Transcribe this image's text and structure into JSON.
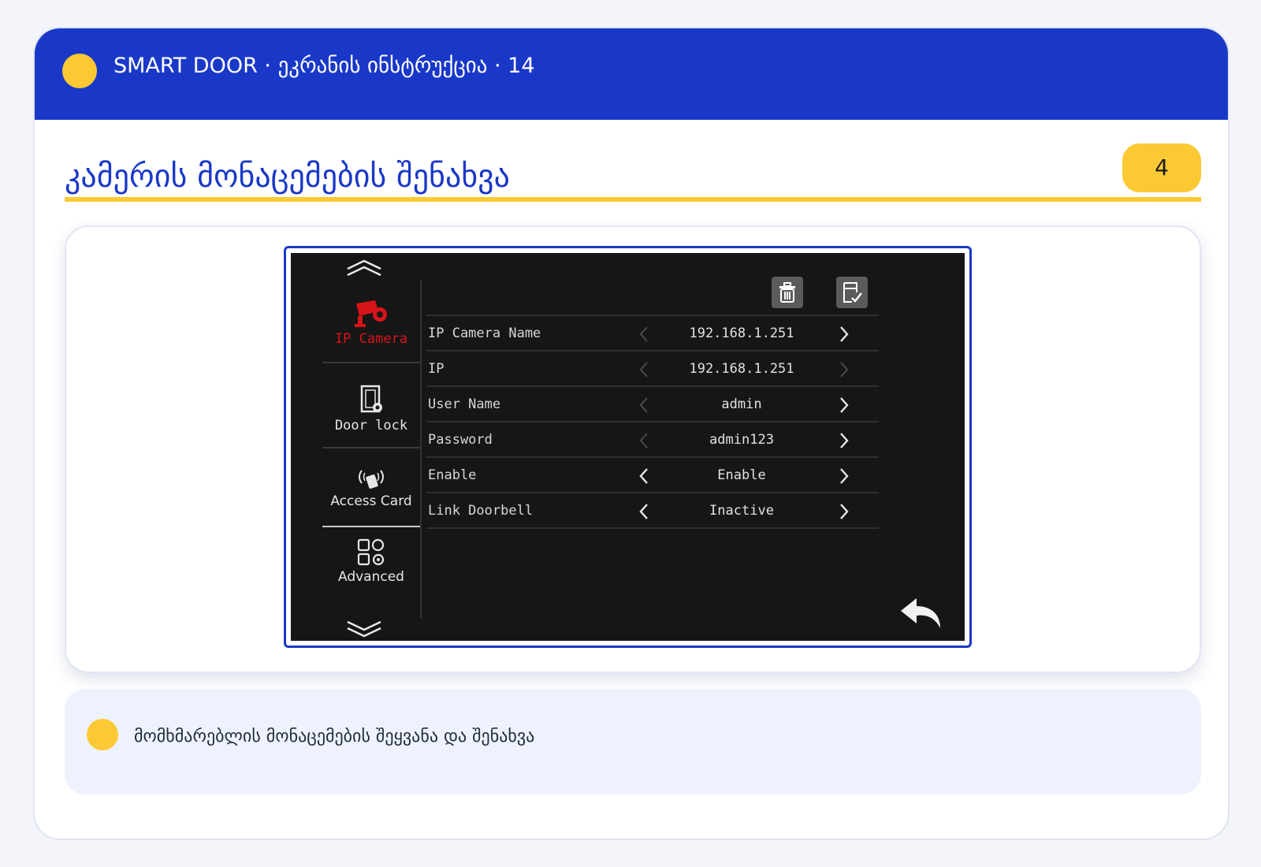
{
  "header": {
    "title": "SMART DOOR · ეკრანის ინსტრუქცია · 14"
  },
  "section": {
    "title": "კამერის მონაცემების შენახვა",
    "step_number": "4"
  },
  "device": {
    "sidebar": [
      {
        "label": "IP Camera",
        "icon": "ip-camera-icon",
        "active": true
      },
      {
        "label": "Door lock",
        "icon": "door-lock-icon",
        "active": false
      },
      {
        "label": "Access Card",
        "icon": "access-card-icon",
        "active": false
      },
      {
        "label": "Advanced",
        "icon": "advanced-settings-icon",
        "active": false
      }
    ],
    "toolbar": {
      "delete_icon": "trash-icon",
      "save_icon": "save-check-icon"
    },
    "rows": [
      {
        "label": "IP Camera Name",
        "value": "192.168.1.251"
      },
      {
        "label": "IP",
        "value": "192.168.1.251"
      },
      {
        "label": "User Name",
        "value": "admin"
      },
      {
        "label": "Password",
        "value": "admin123"
      },
      {
        "label": "Enable",
        "value": "Enable"
      },
      {
        "label": "Link Doorbell",
        "value": "Inactive"
      }
    ],
    "back_icon": "back-arrow-icon"
  },
  "note": {
    "text": "მომხმარებლის მონაცემების შეყვანა და შენახვა"
  },
  "colors": {
    "brand_blue": "#1a38c8",
    "accent_yellow": "#fcc934",
    "active_red": "#d8141a",
    "device_bg": "#161616"
  }
}
